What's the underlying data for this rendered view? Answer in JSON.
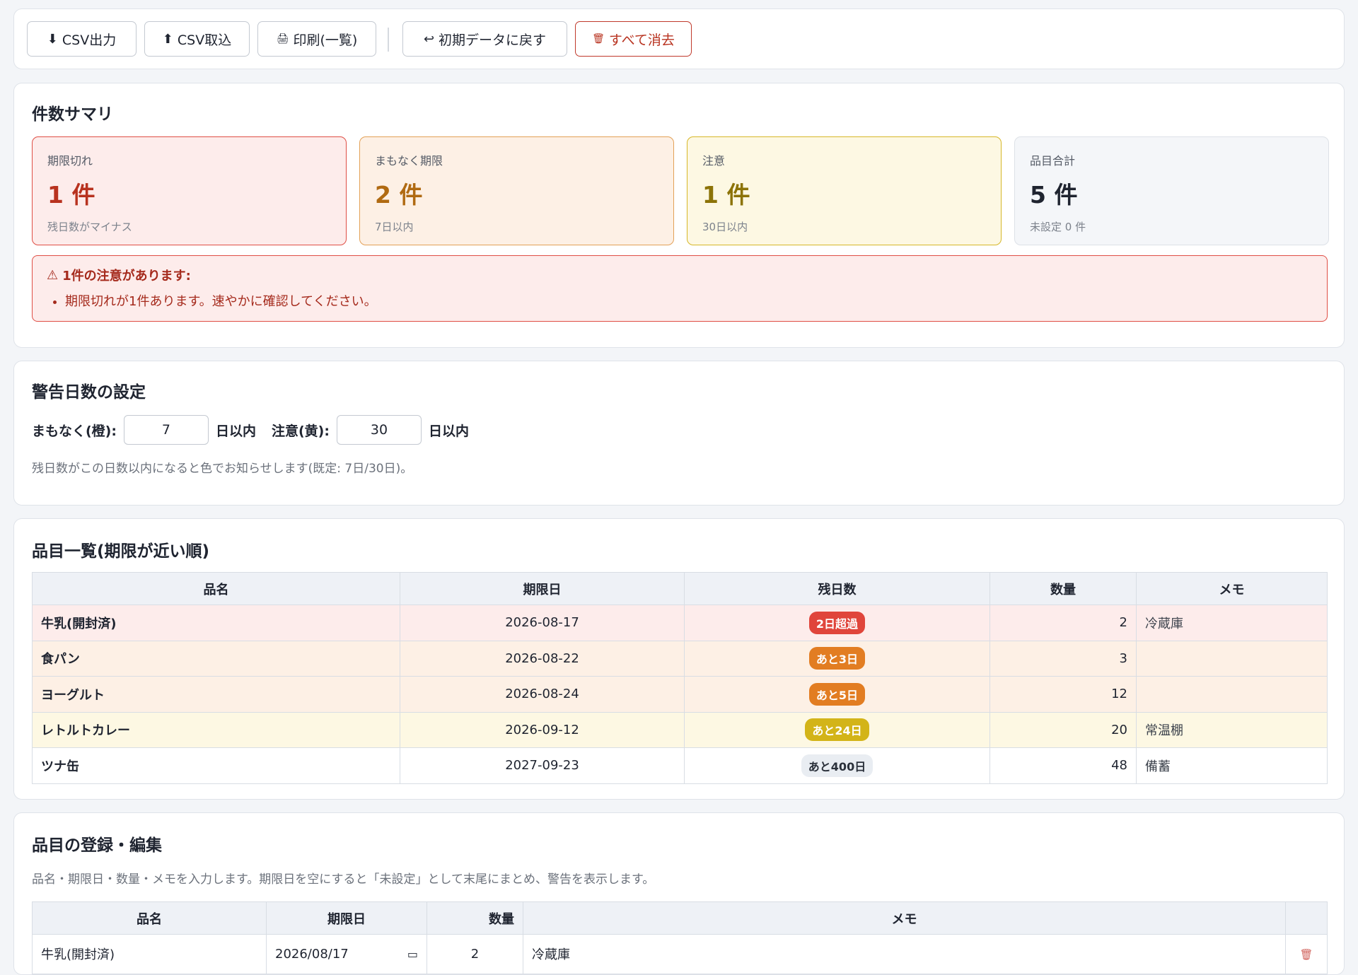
{
  "toolbar": {
    "csv_export": {
      "icon": "⬇",
      "label": "CSV出力"
    },
    "csv_import": {
      "icon": "⬆",
      "label": "CSV取込"
    },
    "print": {
      "icon": "🖨",
      "label": "印刷(一覧)"
    },
    "reset": {
      "icon": "↩",
      "label": "初期データに戻す"
    },
    "clear": {
      "icon": "🗑",
      "label": "すべて消去"
    }
  },
  "summary": {
    "title": "件数サマリ",
    "expired": {
      "label": "期限切れ",
      "value": "1 件",
      "sub": "残日数がマイナス"
    },
    "soon": {
      "label": "まもなく期限",
      "value": "2 件",
      "sub": "7日以内"
    },
    "caution": {
      "label": "注意",
      "value": "1 件",
      "sub": "30日以内"
    },
    "total": {
      "label": "品目合計",
      "value": "5 件",
      "sub": "未設定 0 件"
    },
    "alert": {
      "icon": "⚠",
      "title": "1件の注意があります:",
      "items": [
        "期限切れが1件あります。速やかに確認してください。"
      ]
    }
  },
  "settings": {
    "title": "警告日数の設定",
    "soon_label": "まもなく(橙):",
    "soon_value": "7",
    "unit": "日以内",
    "caution_label": "注意(黄):",
    "caution_value": "30",
    "note": "残日数がこの日数以内になると色でお知らせします(既定: 7日/30日)。"
  },
  "list": {
    "title": "品目一覧(期限が近い順)",
    "headers": [
      "品名",
      "期限日",
      "残日数",
      "数量",
      "メモ"
    ],
    "rows": [
      {
        "name": "牛乳(開封済)",
        "date": "2026-08-17",
        "remain": "2日超過",
        "qty": "2",
        "memo": "冷蔵庫",
        "status": "expired"
      },
      {
        "name": "食パン",
        "date": "2026-08-22",
        "remain": "あと3日",
        "qty": "3",
        "memo": "",
        "status": "soon"
      },
      {
        "name": "ヨーグルト",
        "date": "2026-08-24",
        "remain": "あと5日",
        "qty": "12",
        "memo": "",
        "status": "soon"
      },
      {
        "name": "レトルトカレー",
        "date": "2026-09-12",
        "remain": "あと24日",
        "qty": "20",
        "memo": "常温棚",
        "status": "caution"
      },
      {
        "name": "ツナ缶",
        "date": "2027-09-23",
        "remain": "あと400日",
        "qty": "48",
        "memo": "備蓄",
        "status": "ok"
      }
    ]
  },
  "edit": {
    "title": "品目の登録・編集",
    "note": "品名・期限日・数量・メモを入力します。期限日を空にすると「未設定」として末尾にまとめ、警告を表示します。",
    "headers": [
      "品名",
      "期限日",
      "数量",
      "メモ",
      ""
    ],
    "row": {
      "name": "牛乳(開封済)",
      "date": "2026/08/17",
      "qty": "2",
      "memo": "冷蔵庫"
    }
  },
  "colors": {
    "expired": "#e0453b",
    "soon": "#e27d22",
    "caution": "#d3b418",
    "ok_badge_bg": "#e9edf2"
  }
}
